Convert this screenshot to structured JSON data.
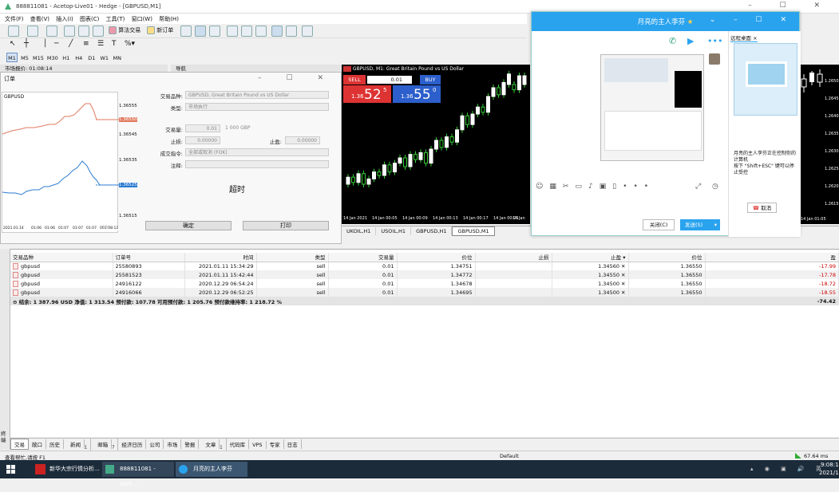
{
  "window": {
    "title": "888811081 - Acetop-Live01 - Hedge - [GBPUSD,M1]"
  },
  "menu": [
    "文件(F)",
    "查看(V)",
    "插入(I)",
    "图表(C)",
    "工具(T)",
    "窗口(W)",
    "帮助(H)"
  ],
  "toolbar": {
    "algo_label": "算法交易",
    "new_order_label": "新订单"
  },
  "timeframes": [
    "M1",
    "M5",
    "M15",
    "M30",
    "H1",
    "H4",
    "D1",
    "W1",
    "MN"
  ],
  "market_watch": {
    "title": "市场报价: 01:08:14"
  },
  "navigator": {
    "title": "导航"
  },
  "order_dialog": {
    "caption": "订单",
    "chart_symbol": "GBPUSD",
    "prices": [
      "1.36555",
      "1.36550",
      "1.36545",
      "1.36535",
      "1.36525",
      "1.36515"
    ],
    "times": [
      "2021.01.14",
      "01:06",
      "01:06",
      "01:07",
      "01:07",
      "01:07",
      "01:08",
      "01:08:12"
    ],
    "symbol_label": "交易品种:",
    "symbol_value": "GBPUSD, Great Britain Pound vs US Dollar",
    "type_label": "类型:",
    "type_value": "市场执行",
    "volume_label": "交易量:",
    "volume_value": "0.01",
    "volume_hint": "1 000 GBP",
    "sl_label": "止损:",
    "sl_value": "0.00000",
    "tp_label": "止盈:",
    "tp_value": "0.00000",
    "fill_label": "成交指令:",
    "fill_value": "全部或取消 (FOK)",
    "comment_label": "注释:",
    "status": "超时",
    "ok_label": "确定",
    "print_label": "打印"
  },
  "chart": {
    "title": "GBPUSD, M1: Great Britain Pound vs US Dollar",
    "sell_label": "SELL",
    "buy_label": "BUY",
    "lot": "0.01",
    "sell_price_a": "1.36",
    "sell_price_b": "52",
    "sell_price_c": "5",
    "buy_price_a": "1.36",
    "buy_price_b": "55",
    "buy_price_c": "0",
    "time_labels": [
      "14 Jan 2021",
      "14 Jan 00:05",
      "14 Jan 00:09",
      "14 Jan 00:13",
      "14 Jan 00:17",
      "14 Jan 00:21",
      "14 Jan"
    ],
    "right_times": [
      "14 Jan 01:05"
    ],
    "right_prices": [
      "1.2650",
      "1.2645",
      "1.2640",
      "1.2635",
      "1.2630",
      "1.2625",
      "1.2620",
      "1.2615"
    ]
  },
  "chart_tabs": [
    "UKOIL,H1",
    "USOIL,H1",
    "GBPUSD,H1",
    "GBPUSD,M1"
  ],
  "trades": {
    "headers": [
      "交易品种",
      "订单号",
      "时间",
      "类型",
      "交易量",
      "价位",
      "止损",
      "止盈",
      "价位",
      "盈"
    ],
    "rows": [
      [
        "gbpusd",
        "25580893",
        "2021.01.11 15:34:29",
        "sell",
        "0.01",
        "1.34751",
        "",
        "1.34560",
        "1.36550",
        "-17.99"
      ],
      [
        "gbpusd",
        "25581523",
        "2021.01.11 15:42:44",
        "sell",
        "0.01",
        "1.34772",
        "",
        "1.34550",
        "1.36550",
        "-17.78"
      ],
      [
        "gbpusd",
        "24916122",
        "2020.12.29 06:54:24",
        "sell",
        "0.01",
        "1.34678",
        "",
        "1.34500",
        "1.36550",
        "-18.72"
      ],
      [
        "gbpusd",
        "24916066",
        "2020.12.29 06:52:25",
        "sell",
        "0.01",
        "1.34695",
        "",
        "1.34500",
        "1.36550",
        "-18.55"
      ]
    ],
    "summary": "结余: 1 387.96 USD  净值: 1 313.54  预付款: 107.78  可用预付款: 1 205.76  预付款维持率: 1 218.72 %",
    "summary_profit": "-74.42"
  },
  "bottom_tabs": [
    "交易",
    "敞口",
    "历史",
    "新闻",
    "邮箱",
    "经济日历",
    "公司",
    "市场",
    "警报",
    "文章",
    "代码库",
    "VPS",
    "专家",
    "日志"
  ],
  "bottom_tab_counts": {
    "新闻": "1",
    "邮箱": "7",
    "文章": "1"
  },
  "terminal_side_label": "终端",
  "status": {
    "help": "查看帮忙,请按 F1",
    "profile": "Default",
    "ping": "67.64 ms"
  },
  "remote": {
    "title": "月亮的主人李芬",
    "tab_label": "远程桌面",
    "notice_1": "月亮的主人李芬正在控制你的计算机",
    "notice_2": "按下 \"Shift+ESC\" 键可以停止受控",
    "cancel_label": "取消",
    "close_label": "关闭(C)",
    "send_label": "发送(S)",
    "accent": "#2aa3ee"
  },
  "taskbar": {
    "items": [
      "新华大宗行情分析...",
      "888811081 - Acet...",
      "月亮的主人李芬"
    ],
    "time": "9:08:1",
    "date": "2021/1"
  }
}
